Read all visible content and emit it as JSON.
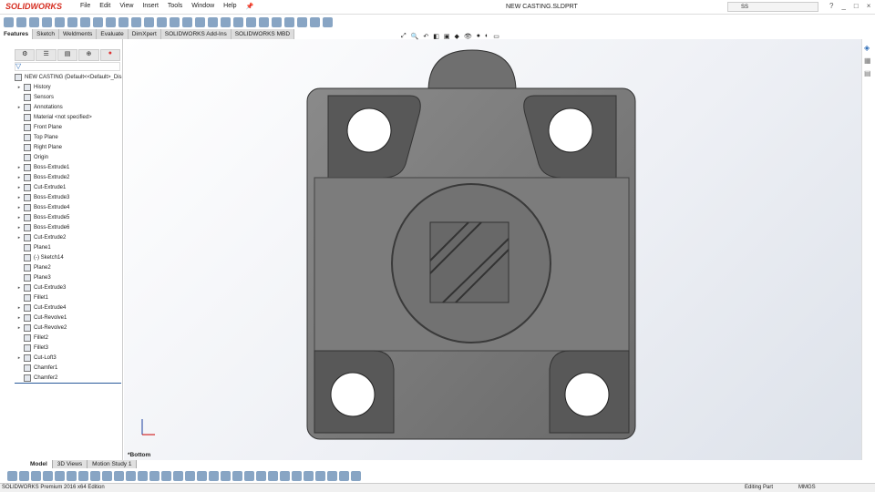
{
  "app": {
    "logo": "SOLIDWORKS",
    "doc_title": "NEW CASTING.SLDPRT",
    "search_value": "SS",
    "window_buttons": [
      "?",
      "_",
      "□",
      "×"
    ]
  },
  "menu": [
    "File",
    "Edit",
    "View",
    "Insert",
    "Tools",
    "Window",
    "Help"
  ],
  "tabs": [
    "Features",
    "Sketch",
    "Weldments",
    "Evaluate",
    "DimXpert",
    "SOLIDWORKS Add-Ins",
    "SOLIDWORKS MBD"
  ],
  "panel_tabs": [
    "feature-manager",
    "property-manager",
    "configuration-manager",
    "dimxpert-manager",
    "display-manager"
  ],
  "tree": {
    "root": "NEW CASTING  (Default<<Default>_Dis",
    "items": [
      {
        "label": "History",
        "exp": true
      },
      {
        "label": "Sensors",
        "exp": false
      },
      {
        "label": "Annotations",
        "exp": true
      },
      {
        "label": "Material <not specified>",
        "exp": false
      },
      {
        "label": "Front Plane",
        "exp": false
      },
      {
        "label": "Top Plane",
        "exp": false
      },
      {
        "label": "Right Plane",
        "exp": false
      },
      {
        "label": "Origin",
        "exp": false
      },
      {
        "label": "Boss-Extrude1",
        "exp": true
      },
      {
        "label": "Boss-Extrude2",
        "exp": true
      },
      {
        "label": "Cut-Extrude1",
        "exp": true
      },
      {
        "label": "Boss-Extrude3",
        "exp": true
      },
      {
        "label": "Boss-Extrude4",
        "exp": true
      },
      {
        "label": "Boss-Extrude5",
        "exp": true
      },
      {
        "label": "Boss-Extrude6",
        "exp": true
      },
      {
        "label": "Cut-Extrude2",
        "exp": true
      },
      {
        "label": "Plane1",
        "exp": false
      },
      {
        "label": "(-) Sketch14",
        "exp": false
      },
      {
        "label": "Plane2",
        "exp": false
      },
      {
        "label": "Plane3",
        "exp": false
      },
      {
        "label": "Cut-Extrude3",
        "exp": true
      },
      {
        "label": "Fillet1",
        "exp": false
      },
      {
        "label": "Cut-Extrude4",
        "exp": true
      },
      {
        "label": "Cut-Revolve1",
        "exp": true
      },
      {
        "label": "Cut-Revolve2",
        "exp": true
      },
      {
        "label": "Fillet2",
        "exp": false
      },
      {
        "label": "Fillet3",
        "exp": false
      },
      {
        "label": "Cut-Loft3",
        "exp": true
      },
      {
        "label": "Chamfer1",
        "exp": false
      },
      {
        "label": "Chamfer2",
        "exp": false
      }
    ]
  },
  "viewport": {
    "view_label": "*Bottom"
  },
  "bottom_tabs": [
    "Model",
    "3D Views",
    "Motion Study 1"
  ],
  "status": {
    "edition": "SOLIDWORKS Premium 2016 x64 Edition",
    "mode": "Editing Part",
    "units": "MMGS"
  }
}
